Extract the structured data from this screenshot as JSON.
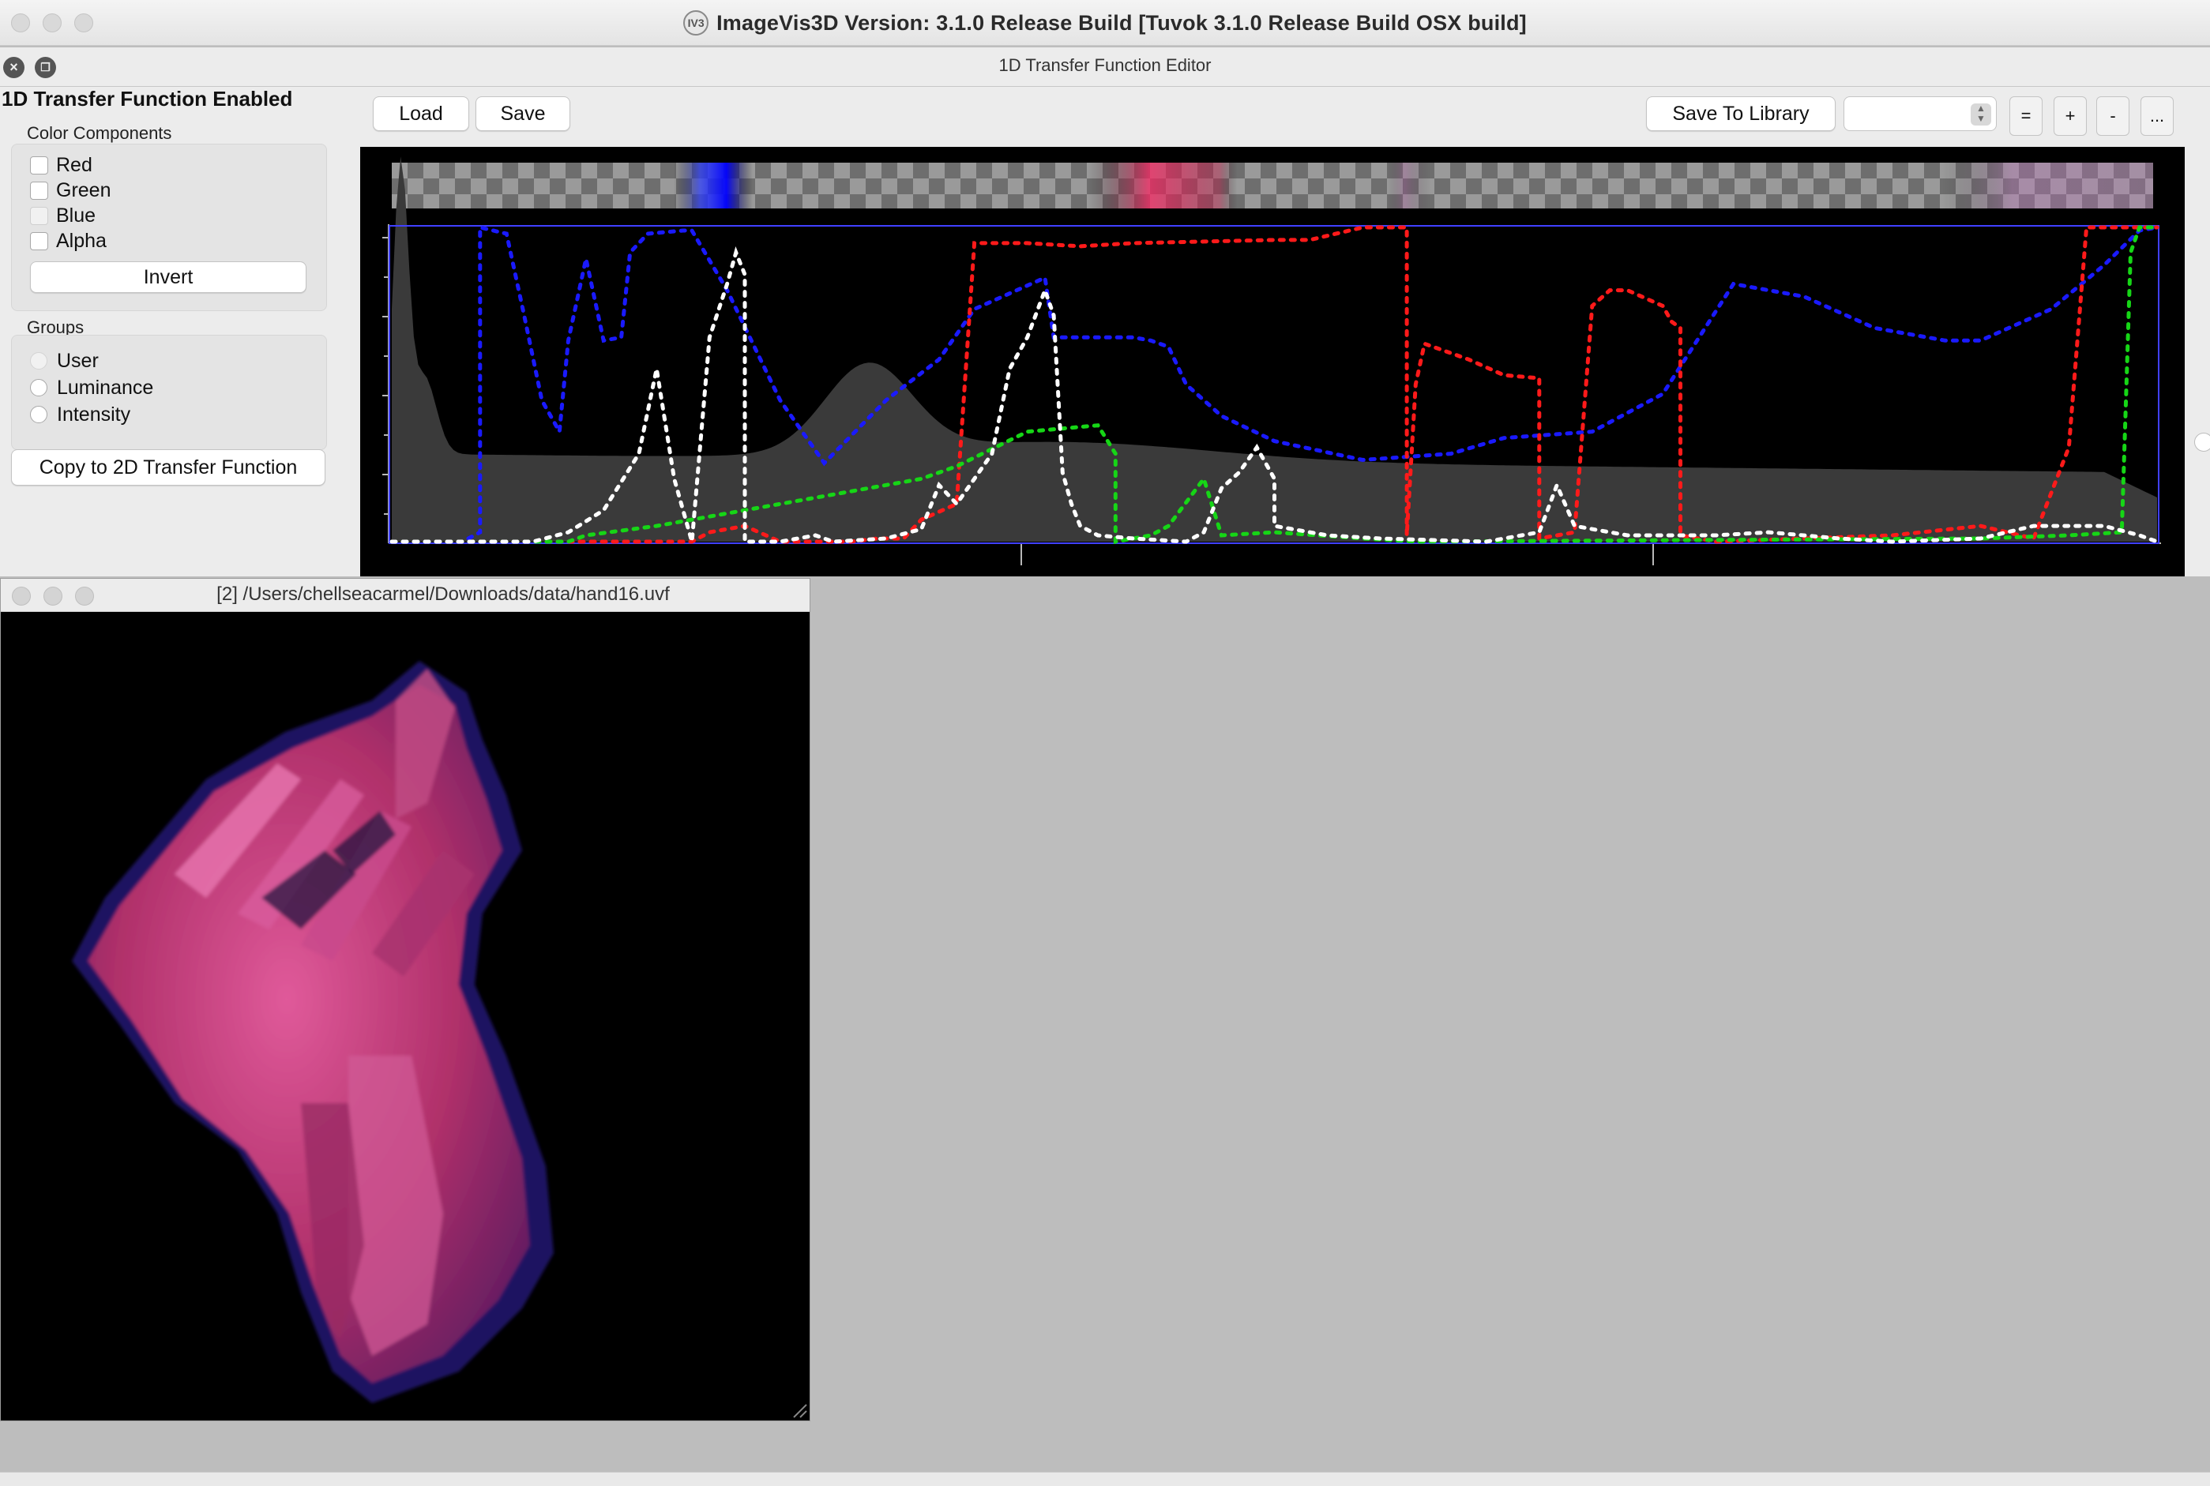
{
  "window": {
    "title": "ImageVis3D Version: 3.1.0 Release Build [Tuvok 3.1.0 Release Build OSX build]",
    "app_icon_text": "IV3"
  },
  "tf_editor": {
    "dock_title": "1D Transfer Function Editor",
    "enabled_label": "1D Transfer Function Enabled",
    "color_components": {
      "title": "Color Components",
      "items": [
        "Red",
        "Green",
        "Blue",
        "Alpha"
      ],
      "invert_label": "Invert"
    },
    "groups": {
      "title": "Groups",
      "items": [
        "User",
        "Luminance",
        "Intensity"
      ]
    },
    "copy_label": "Copy to 2D Transfer Function",
    "toolbar": {
      "load_label": "Load",
      "save_label": "Save",
      "save_library_label": "Save To Library",
      "library_value": "",
      "equals_label": "=",
      "plus_label": "+",
      "minus_label": "-",
      "more_label": "..."
    },
    "curve_colors": {
      "red": "#ff1a1a",
      "green": "#16d616",
      "blue": "#1a1aff",
      "alpha": "#ffffff",
      "histogram": "#3c3c3c",
      "frame": "#4040ff"
    }
  },
  "render_window": {
    "title": "[2] /Users/chellseacarmel/Downloads/data/hand16.uvf",
    "volume_colors": {
      "primary": "#b0306a",
      "highlight": "#e05a9a",
      "rim": "#3b2fb8"
    }
  }
}
